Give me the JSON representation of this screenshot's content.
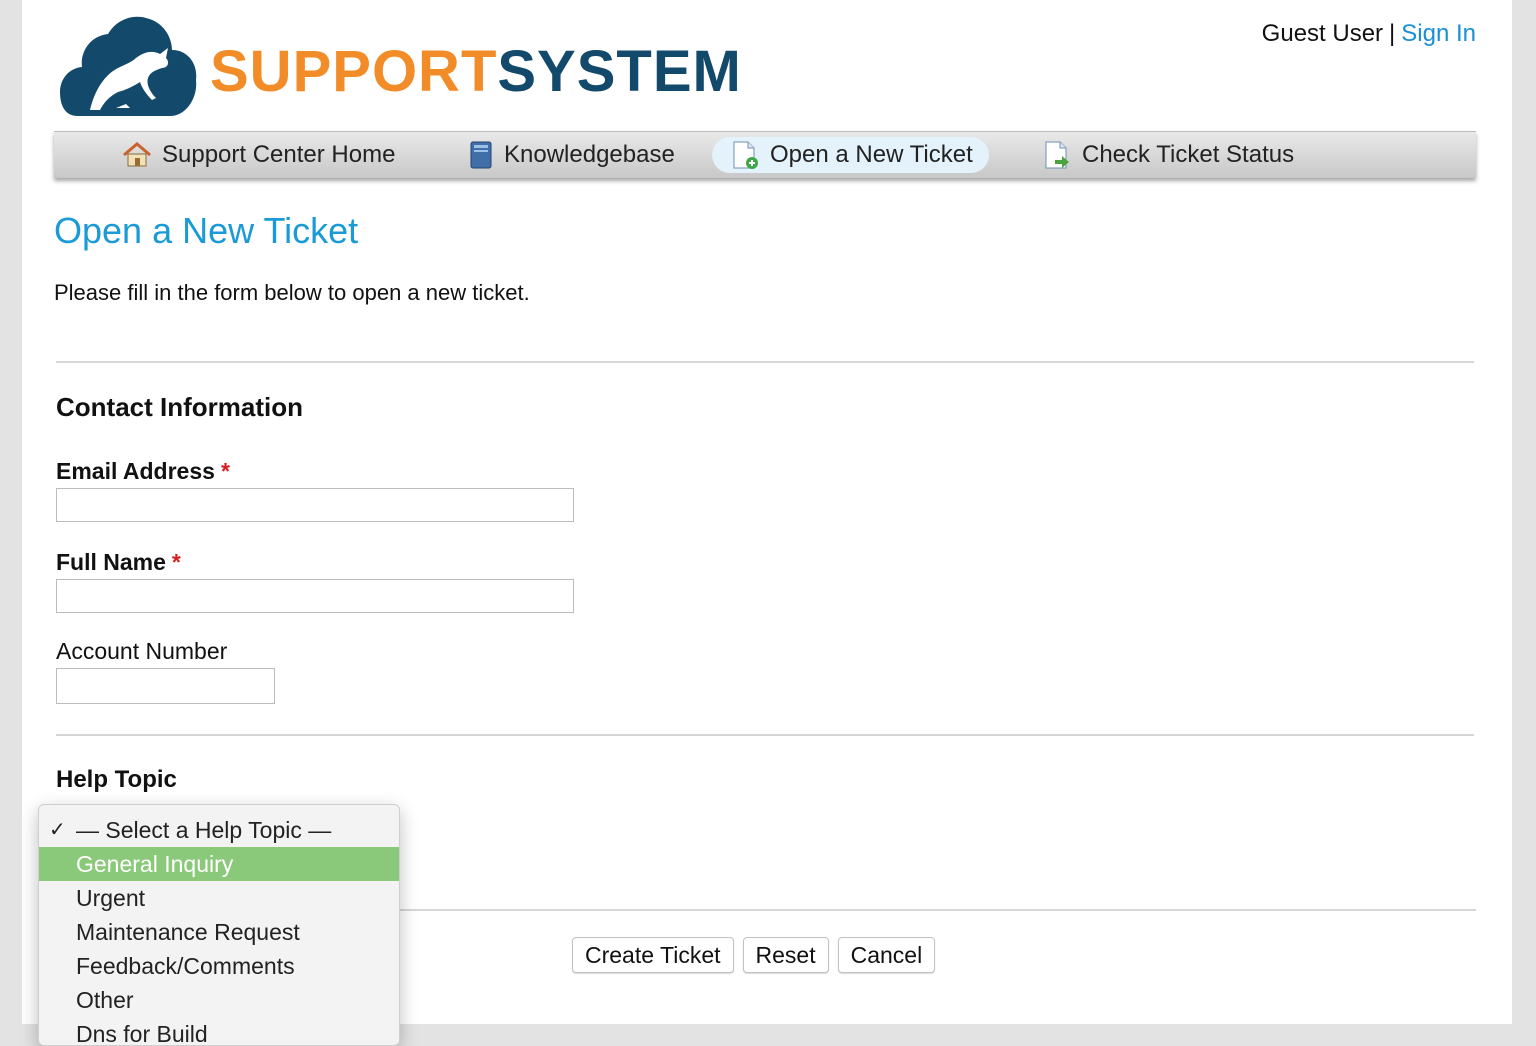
{
  "brand": {
    "word1": "SUPPORT",
    "word2": "SYSTEM",
    "orange": "#f28c28",
    "navy": "#134a6b"
  },
  "user": {
    "name": "Guest User",
    "separator": "|",
    "sign_in": "Sign In"
  },
  "nav": {
    "items": [
      {
        "label": "Support Center Home",
        "icon": "home-icon"
      },
      {
        "label": "Knowledgebase",
        "icon": "book-icon"
      },
      {
        "label": "Open a New Ticket",
        "icon": "new-ticket-icon",
        "active": true
      },
      {
        "label": "Check Ticket Status",
        "icon": "ticket-status-icon"
      }
    ]
  },
  "page": {
    "title": "Open a New Ticket",
    "intro": "Please fill in the form below to open a new ticket."
  },
  "contact": {
    "heading": "Contact Information",
    "email_label": "Email Address",
    "email_value": "",
    "name_label": "Full Name",
    "name_value": "",
    "account_label": "Account Number",
    "account_value": "",
    "required_mark": "*"
  },
  "help_topic": {
    "heading": "Help Topic",
    "check_mark": "✓",
    "options": [
      "— Select a Help Topic —",
      "General Inquiry",
      "Urgent",
      "Maintenance Request",
      "Feedback/Comments",
      "Other",
      "Dns for Build"
    ],
    "selected_index": 0,
    "highlighted_index": 1
  },
  "actions": {
    "create": "Create Ticket",
    "reset": "Reset",
    "cancel": "Cancel"
  },
  "colors": {
    "link": "#1a8fd6",
    "title": "#1a9ad6",
    "highlight": "#8bc97a",
    "required": "#d61f1f"
  }
}
